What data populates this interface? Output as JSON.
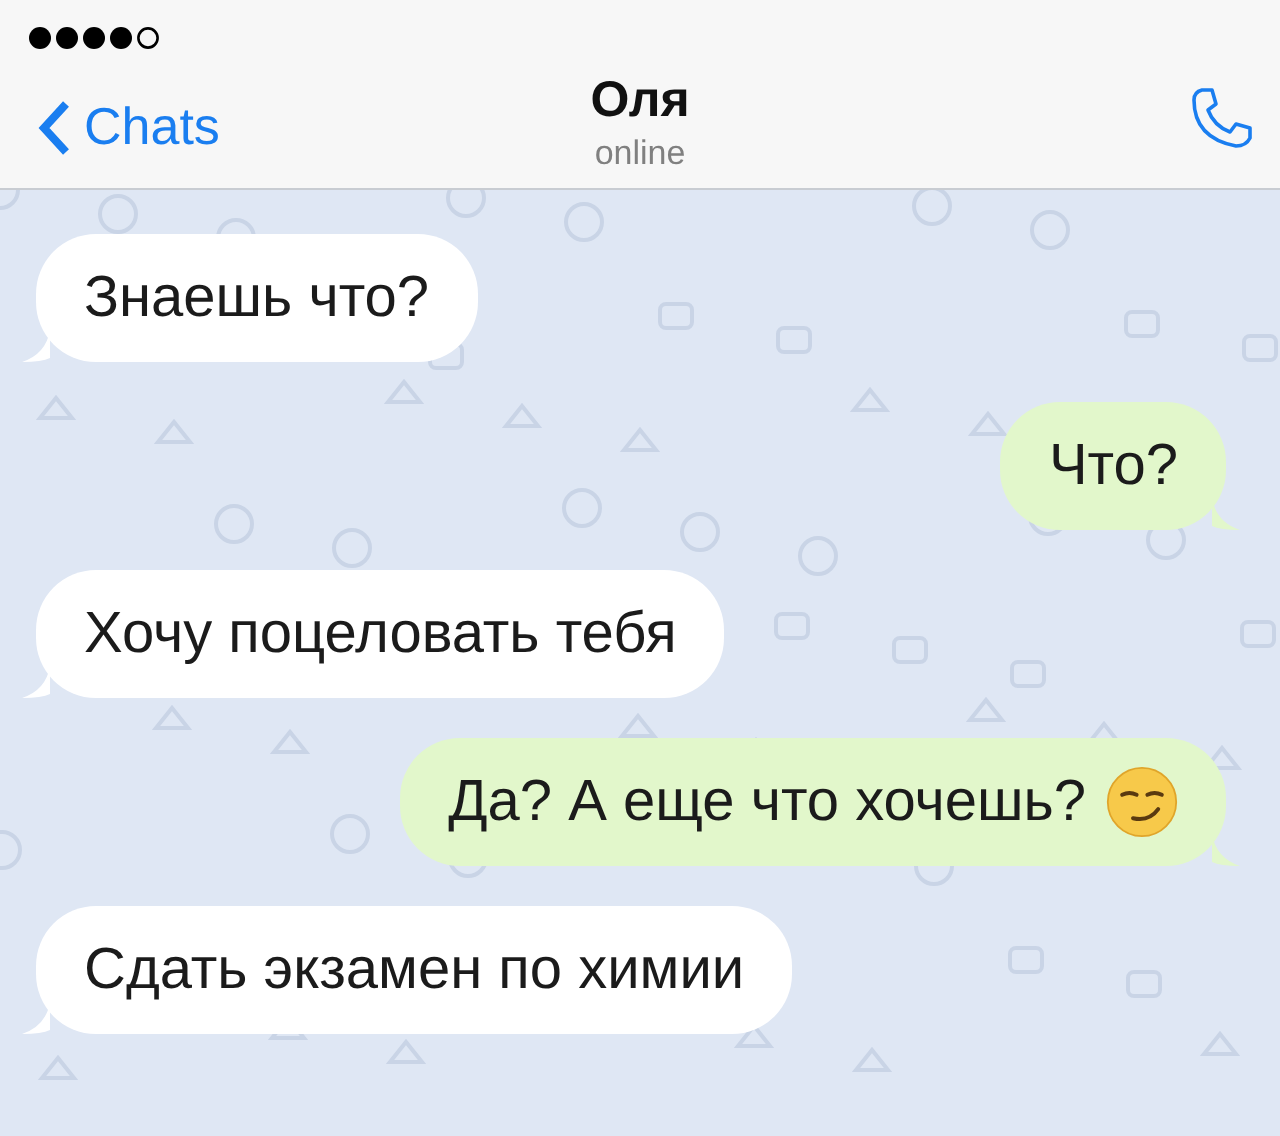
{
  "header": {
    "back_label": "Chats",
    "title": "Оля",
    "status": "online"
  },
  "messages": [
    {
      "kind": "incoming",
      "text": "Знаешь что?"
    },
    {
      "kind": "outgoing",
      "text": "Что?"
    },
    {
      "kind": "incoming",
      "text": "Хочу поцеловать тебя"
    },
    {
      "kind": "outgoing",
      "text": "Да? А еще что хочешь?",
      "emoji": true
    },
    {
      "kind": "incoming",
      "text": "Сдать экзамен по химии"
    }
  ]
}
